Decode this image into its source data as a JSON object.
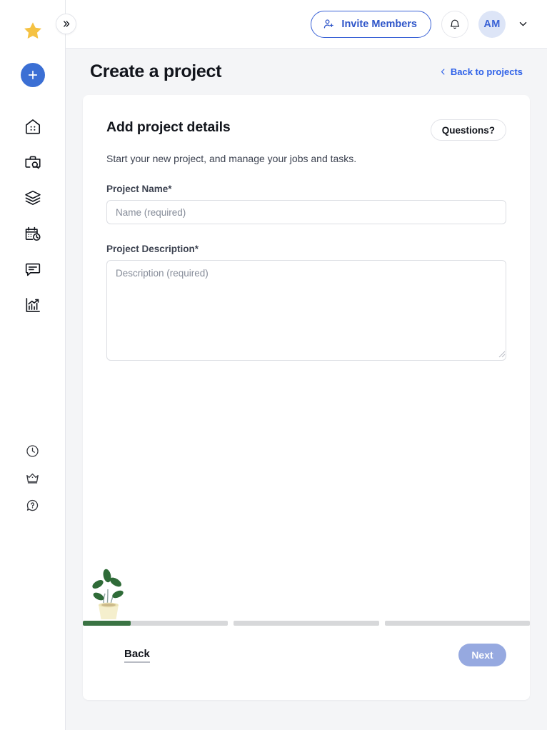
{
  "brand": {
    "logo_icon": "star-icon",
    "logo_color": "#f5c243",
    "accent_blue": "#3b6fd4",
    "link_blue": "#2f62e8",
    "progress_green": "#3a7343",
    "next_button_color": "#96a9e0",
    "page_background": "#f4f5f7"
  },
  "sidebar": {
    "collapse_button": {
      "icon": "chevrons-right-icon"
    },
    "add_button": {
      "icon": "plus-icon"
    },
    "items": [
      {
        "label": "Home",
        "icon": "home-icon"
      },
      {
        "label": "Jobs",
        "icon": "briefcase-search-icon"
      },
      {
        "label": "Projects",
        "icon": "layers-icon"
      },
      {
        "label": "Schedule",
        "icon": "calendar-clock-icon"
      },
      {
        "label": "Messages",
        "icon": "chat-icon"
      },
      {
        "label": "Reports",
        "icon": "chart-growth-icon"
      }
    ],
    "bottom_items": [
      {
        "label": "Time",
        "icon": "clock-icon"
      },
      {
        "label": "Upgrade",
        "icon": "crown-icon"
      },
      {
        "label": "Help",
        "icon": "help-circle-icon"
      }
    ]
  },
  "topbar": {
    "invite_label": "Invite Members",
    "invite_icon": "person-add-icon",
    "notification_icon": "bell-icon",
    "avatar_initials": "AM",
    "caret_icon": "chevron-down-icon"
  },
  "page": {
    "title": "Create a project",
    "back_link": "Back to projects",
    "back_link_icon": "chevron-left-icon"
  },
  "card": {
    "title": "Add project details",
    "questions_label": "Questions?",
    "subtitle": "Start your new project, and manage your jobs and tasks.",
    "fields": [
      {
        "label": "Project Name*",
        "placeholder": "Name (required)",
        "value": ""
      },
      {
        "label": "Project Description*",
        "placeholder": "Description (required)",
        "value": ""
      }
    ],
    "illustration": "plant-seedling-icon"
  },
  "progress": {
    "steps": 3,
    "current_step": 1,
    "fill_percent": 33
  },
  "footer": {
    "back_label": "Back",
    "next_label": "Next"
  }
}
